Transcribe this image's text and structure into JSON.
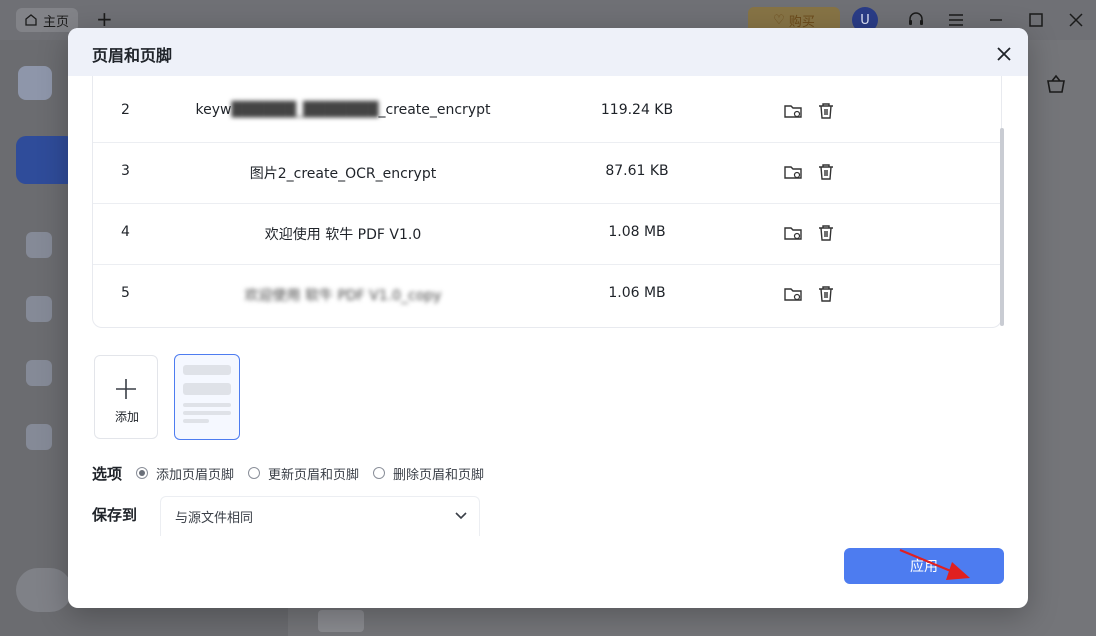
{
  "app": {
    "home_tab": "主页",
    "buy_label": "购买",
    "avatar_initial": "U"
  },
  "modal": {
    "title": "页眉和页脚",
    "files": [
      {
        "index": "2",
        "name": "keyw██████_███████_create_encrypt",
        "size": "119.24 KB",
        "blurred": true
      },
      {
        "index": "3",
        "name": "图片2_create_OCR_encrypt",
        "size": "87.61 KB",
        "blurred": false
      },
      {
        "index": "4",
        "name": "欢迎使用 软牛 PDF V1.0",
        "size": "1.08 MB",
        "blurred": false
      },
      {
        "index": "5",
        "name": "欢迎使用 软牛 PDF V1.0_copy",
        "size": "1.06 MB",
        "blurred": true
      }
    ],
    "add_label": "添加",
    "options_label": "选项",
    "options": [
      {
        "label": "添加页眉页脚",
        "checked": true
      },
      {
        "label": "更新页眉和页脚",
        "checked": false
      },
      {
        "label": "删除页眉和页脚",
        "checked": false
      }
    ],
    "save_to_label": "保存到",
    "save_to_value": "与源文件相同",
    "apply_label": "应用"
  },
  "colors": {
    "accent": "#4d7cf0",
    "header_bg": "#eef1f9",
    "arrow": "#e02020"
  },
  "icons": {
    "folder_settings": "folder-settings-icon",
    "delete": "trash-icon",
    "close": "close-icon",
    "chevron": "chevron-down-icon"
  }
}
